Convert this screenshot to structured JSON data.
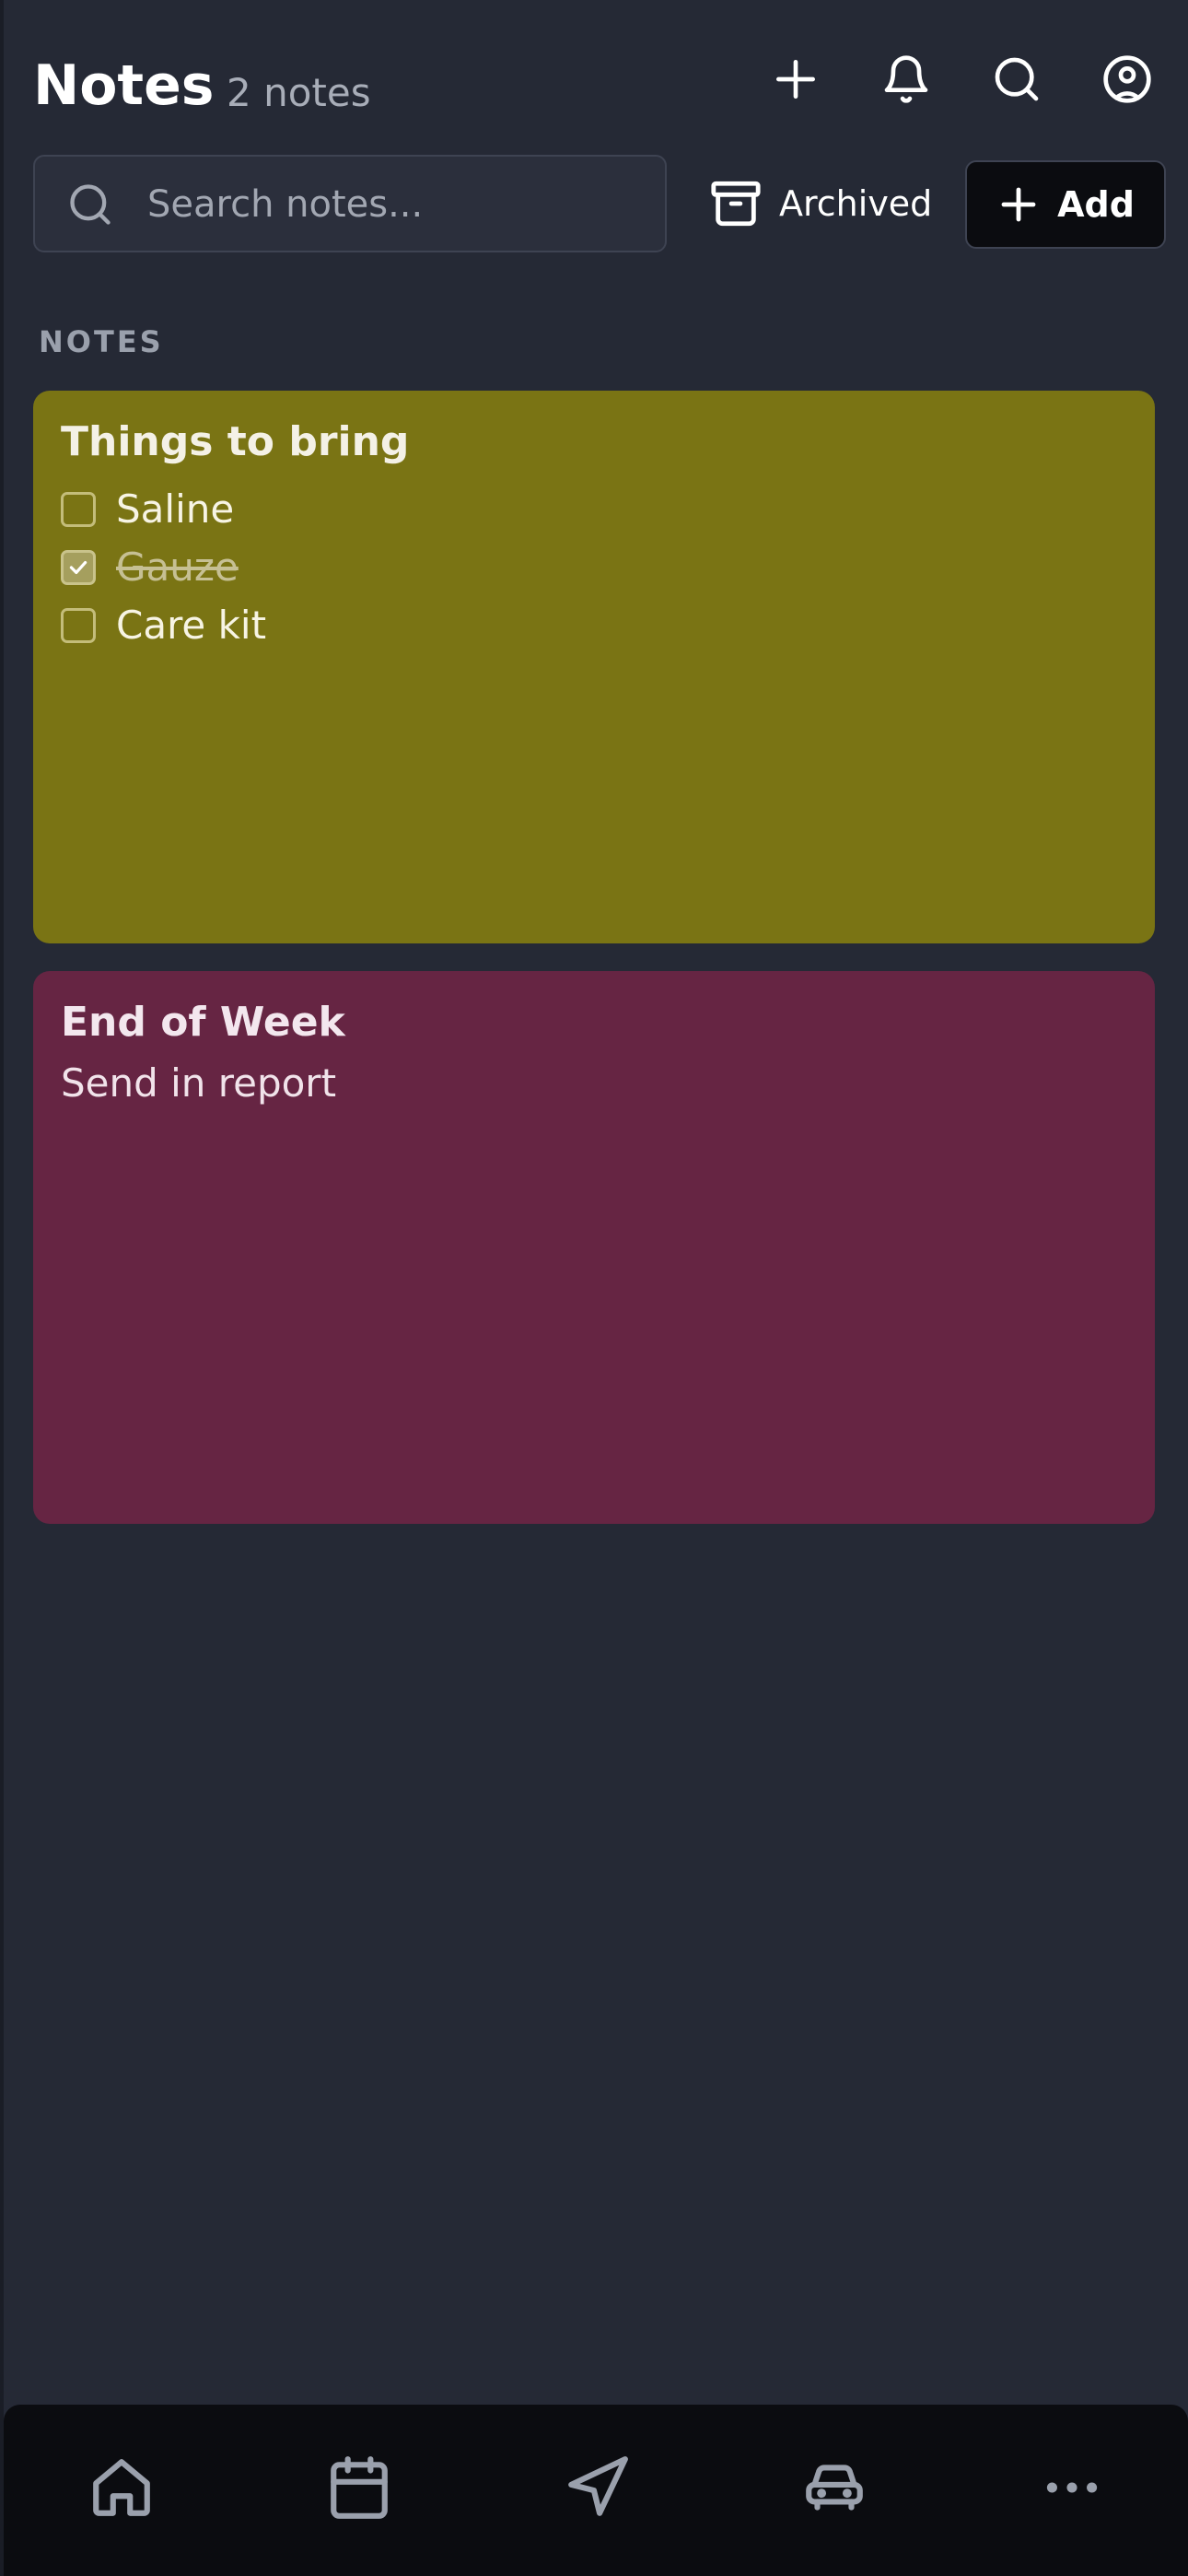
{
  "header": {
    "title": "Notes",
    "count": "2 notes",
    "icons": [
      "plus-icon",
      "bell-icon",
      "search-icon",
      "user-circle-icon"
    ]
  },
  "search": {
    "placeholder": "Search notes...",
    "value": ""
  },
  "toolbar": {
    "archived_label": "Archived",
    "add_label": "Add"
  },
  "section": {
    "label": "NOTES"
  },
  "notes": [
    {
      "title": "Things to bring",
      "color": "#7a7414",
      "checklist": [
        {
          "text": "Saline",
          "checked": false
        },
        {
          "text": "Gauze",
          "checked": true
        },
        {
          "text": "Care kit",
          "checked": false
        }
      ]
    },
    {
      "title": "End of Week",
      "color": "#662543",
      "body": "Send in report"
    }
  ],
  "bottom_nav": {
    "items": [
      "home-icon",
      "calendar-icon",
      "navigation-icon",
      "car-icon",
      "more-icon"
    ]
  },
  "colors": {
    "background": "#252935",
    "nav_background": "#0b0c10",
    "muted_text": "#a8adb8"
  }
}
